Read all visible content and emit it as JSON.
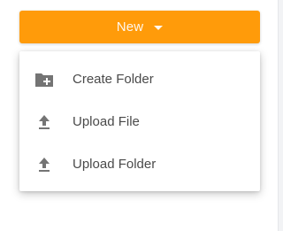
{
  "new_button": {
    "label": "New",
    "color": "#ff9b0a"
  },
  "menu": {
    "items": [
      {
        "label": "Create Folder",
        "icon": "folder-add-icon"
      },
      {
        "label": "Upload File",
        "icon": "upload-icon"
      },
      {
        "label": "Upload Folder",
        "icon": "upload-icon"
      }
    ]
  }
}
